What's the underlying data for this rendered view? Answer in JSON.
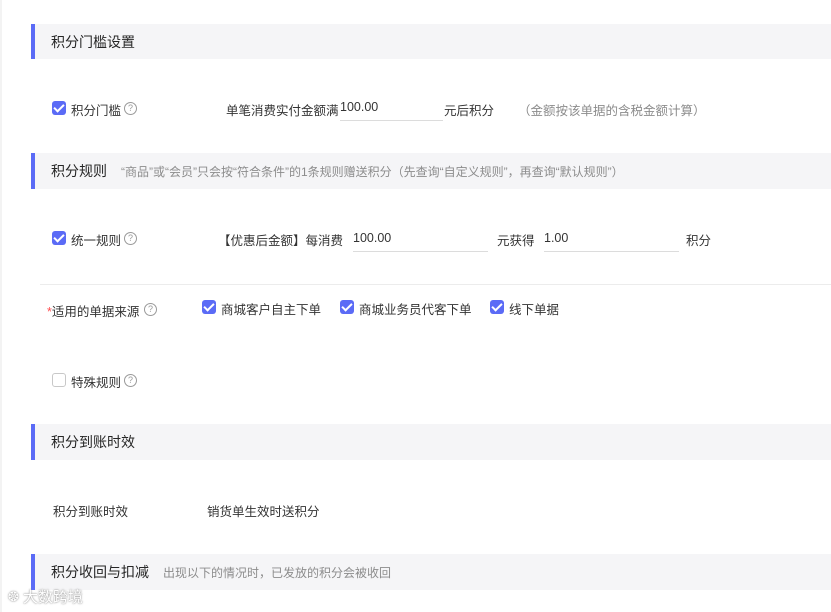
{
  "sections": {
    "threshold": {
      "title": "积分门槛设置"
    },
    "rules": {
      "title": "积分规则",
      "note": "“商品”或“会员”只会按“符合条件”的1条规则赠送积分（先查询“自定义规则”，再查询“默认规则”）"
    },
    "arrival": {
      "title": "积分到账时效"
    },
    "recall": {
      "title": "积分收回与扣减",
      "note": "出现以下的情况时，已发放的积分会被收回"
    }
  },
  "threshold": {
    "checkbox_label": "积分门槛",
    "checked": true,
    "prefix": "单笔消费实付金额满",
    "amount": "100.00",
    "suffix": "元后积分",
    "hint": "（金额按该单据的含税金额计算）"
  },
  "unified_rule": {
    "checkbox_label": "统一规则",
    "checked": true,
    "prefix": "【优惠后金额】每消费",
    "amount": "100.00",
    "middle": "元获得",
    "points": "1.00",
    "suffix": "积分"
  },
  "sources": {
    "required_mark": "*",
    "label": "适用的单据来源",
    "options": [
      {
        "label": "商城客户自主下单",
        "checked": true
      },
      {
        "label": "商城业务员代客下单",
        "checked": true
      },
      {
        "label": "线下单据",
        "checked": true
      }
    ]
  },
  "special_rule": {
    "checkbox_label": "特殊规则",
    "checked": false
  },
  "arrival": {
    "label": "积分到账时效",
    "value": "销货单生效时送积分"
  },
  "watermark": {
    "icon": "weibo-icon",
    "text": "大数跨境"
  },
  "help_glyph": "?",
  "colors": {
    "accent": "#5b6bf6",
    "section_bg": "#f5f5f7",
    "required": "#ff4d4f"
  }
}
